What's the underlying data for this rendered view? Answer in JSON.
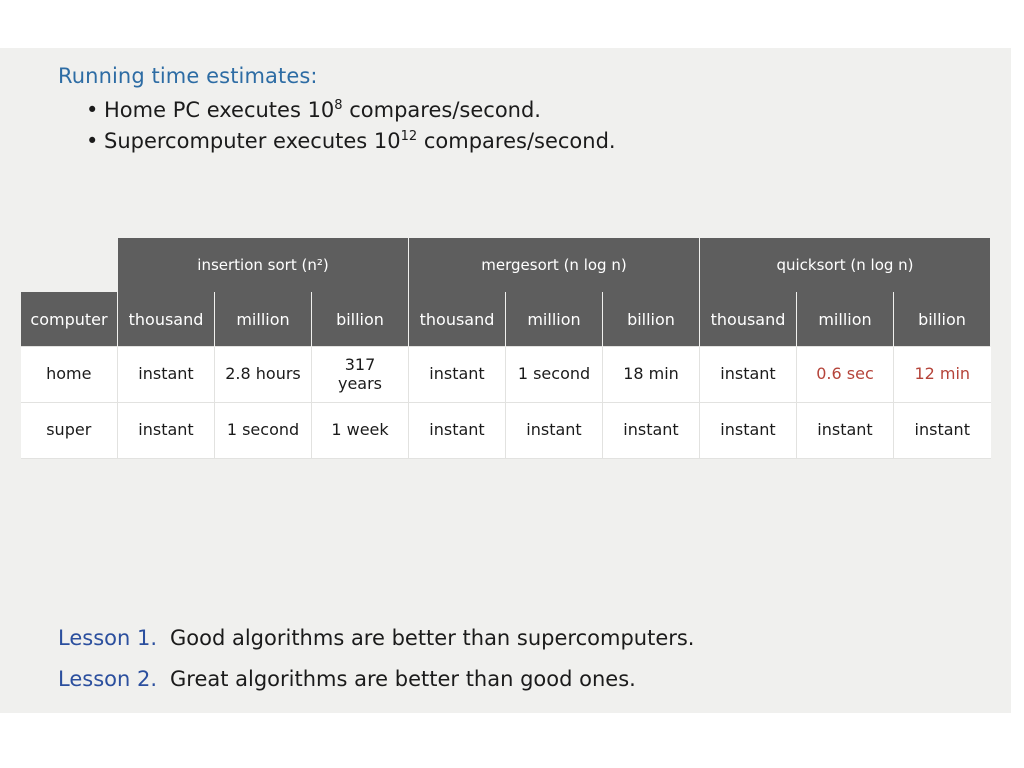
{
  "slide": {
    "title": "Running time estimates:",
    "bullets": [
      {
        "prefix": "Home PC executes 10",
        "exponent": "8",
        "suffix": " compares/second."
      },
      {
        "prefix": "Supercomputer executes 10",
        "exponent": "12",
        "suffix": " compares/second."
      }
    ],
    "bullet_marker": "•"
  },
  "table": {
    "corner_label": "computer",
    "groups": [
      {
        "label": "insertion sort (n²)",
        "span": 3
      },
      {
        "label": "mergesort (n log n)",
        "span": 3
      },
      {
        "label": "quicksort (n log n)",
        "span": 3
      }
    ],
    "subheaders": [
      "thousand",
      "million",
      "billion",
      "thousand",
      "million",
      "billion",
      "thousand",
      "million",
      "billion"
    ],
    "rows": [
      {
        "label": "home",
        "cells": [
          {
            "text": "instant",
            "highlight": false,
            "lines": [
              "instant"
            ]
          },
          {
            "text": "2.8 hours",
            "highlight": false,
            "lines": [
              "2.8 hours"
            ]
          },
          {
            "text": "317 years",
            "highlight": false,
            "lines": [
              "317",
              "years"
            ]
          },
          {
            "text": "instant",
            "highlight": false,
            "lines": [
              "instant"
            ]
          },
          {
            "text": "1 second",
            "highlight": false,
            "lines": [
              "1 second"
            ]
          },
          {
            "text": "18 min",
            "highlight": false,
            "lines": [
              "18 min"
            ]
          },
          {
            "text": "instant",
            "highlight": false,
            "lines": [
              "instant"
            ]
          },
          {
            "text": "0.6 sec",
            "highlight": true,
            "lines": [
              "0.6 sec"
            ]
          },
          {
            "text": "12 min",
            "highlight": true,
            "lines": [
              "12 min"
            ]
          }
        ]
      },
      {
        "label": "super",
        "cells": [
          {
            "text": "instant",
            "highlight": false,
            "lines": [
              "instant"
            ]
          },
          {
            "text": "1 second",
            "highlight": false,
            "lines": [
              "1 second"
            ]
          },
          {
            "text": "1 week",
            "highlight": false,
            "lines": [
              "1 week"
            ]
          },
          {
            "text": "instant",
            "highlight": false,
            "lines": [
              "instant"
            ]
          },
          {
            "text": "instant",
            "highlight": false,
            "lines": [
              "instant"
            ]
          },
          {
            "text": "instant",
            "highlight": false,
            "lines": [
              "instant"
            ]
          },
          {
            "text": "instant",
            "highlight": false,
            "lines": [
              "instant"
            ]
          },
          {
            "text": "instant",
            "highlight": false,
            "lines": [
              "instant"
            ]
          },
          {
            "text": "instant",
            "highlight": false,
            "lines": [
              "instant"
            ]
          }
        ]
      }
    ]
  },
  "lessons": [
    {
      "label": "Lesson 1.",
      "text": "Good algorithms are better than supercomputers."
    },
    {
      "label": "Lesson 2.",
      "text": "Great algorithms are better than good ones."
    }
  ],
  "colors": {
    "title_blue": "#2d6ca4",
    "lesson_blue": "#2b4f9e",
    "header_gray": "#5e5e5e",
    "highlight_red": "#b5443a",
    "slide_bg": "#f0f0ee",
    "page_bg": "#ffffff"
  }
}
